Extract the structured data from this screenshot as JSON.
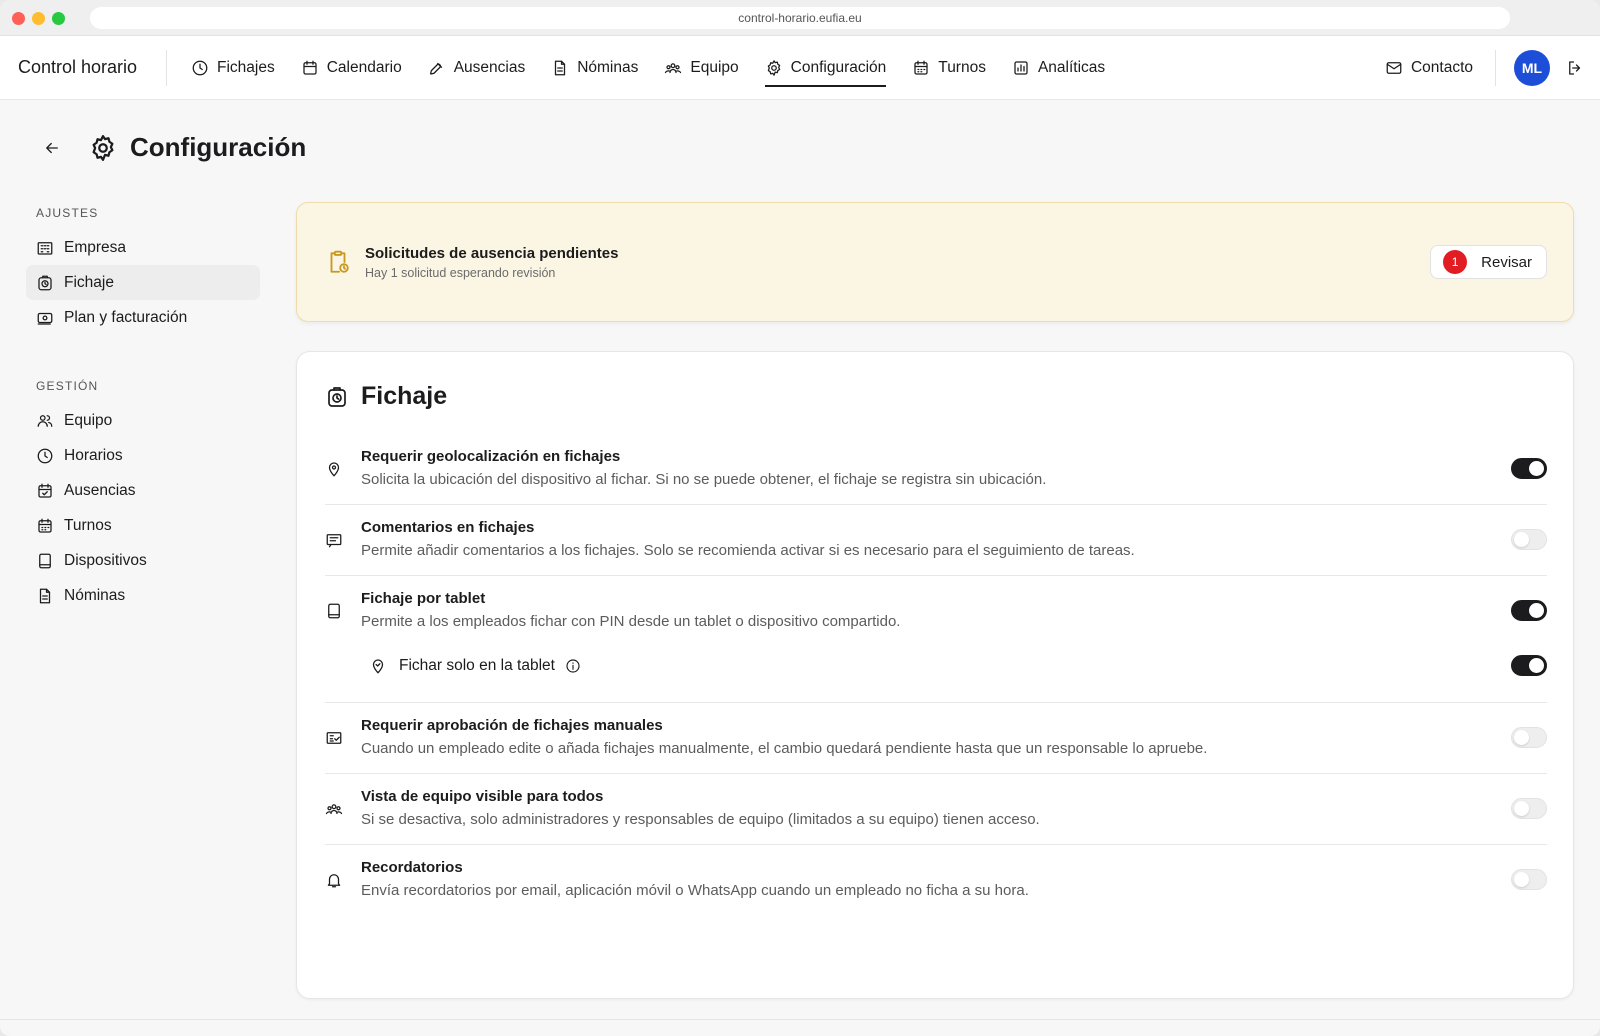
{
  "browser": {
    "url": "control-horario.eufia.eu"
  },
  "app": {
    "brand": "Control horario"
  },
  "nav": {
    "items": [
      {
        "label": "Fichajes",
        "icon": "clock-icon"
      },
      {
        "label": "Calendario",
        "icon": "calendar-icon"
      },
      {
        "label": "Ausencias",
        "icon": "plane-icon"
      },
      {
        "label": "Nóminas",
        "icon": "document-icon"
      },
      {
        "label": "Equipo",
        "icon": "team-icon"
      },
      {
        "label": "Configuración",
        "icon": "gear-icon",
        "active": true
      },
      {
        "label": "Turnos",
        "icon": "calendar-icon"
      },
      {
        "label": "Analíticas",
        "icon": "chart-icon"
      }
    ],
    "contact": "Contacto",
    "avatar_initials": "ML",
    "avatar_color": "#1d4ed8"
  },
  "page": {
    "title": "Configuración"
  },
  "sidebar": {
    "groups": [
      {
        "title": "AJUSTES",
        "items": [
          {
            "label": "Empresa",
            "icon": "building-icon"
          },
          {
            "label": "Fichaje",
            "icon": "clock-box-icon",
            "active": true
          },
          {
            "label": "Plan y facturación",
            "icon": "money-icon"
          }
        ]
      },
      {
        "title": "GESTIÓN",
        "items": [
          {
            "label": "Equipo",
            "icon": "users-icon"
          },
          {
            "label": "Horarios",
            "icon": "clock-icon"
          },
          {
            "label": "Ausencias",
            "icon": "calendar-check-icon"
          },
          {
            "label": "Turnos",
            "icon": "calendar-icon"
          },
          {
            "label": "Dispositivos",
            "icon": "tablet-icon"
          },
          {
            "label": "Nóminas",
            "icon": "document-icon"
          }
        ]
      }
    ]
  },
  "alert": {
    "title": "Solicitudes de ausencia pendientes",
    "subtitle": "Hay 1 solicitud esperando revisión",
    "badge": "1",
    "button": "Revisar",
    "accent": "#e11d23"
  },
  "card": {
    "title": "Fichaje",
    "settings": [
      {
        "title": "Requerir geolocalización en fichajes",
        "desc": "Solicita la ubicación del dispositivo al fichar. Si no se puede obtener, el fichaje se registra sin ubicación.",
        "on": true,
        "icon": "location-pin-icon"
      },
      {
        "title": "Comentarios en fichajes",
        "desc": "Permite añadir comentarios a los fichajes. Solo se recomienda activar si es necesario para el seguimiento de tareas.",
        "on": false,
        "icon": "comment-icon"
      },
      {
        "title": "Fichaje por tablet",
        "desc": "Permite a los empleados fichar con PIN desde un tablet o dispositivo compartido.",
        "on": true,
        "icon": "tablet-icon",
        "sub": {
          "label": "Fichar solo en la tablet",
          "on": true
        }
      },
      {
        "title": "Requerir aprobación de fichajes manuales",
        "desc": "Cuando un empleado edite o añada fichajes manualmente, el cambio quedará pendiente hasta que un responsable lo apruebe.",
        "on": false,
        "icon": "checklist-icon"
      },
      {
        "title": "Vista de equipo visible para todos",
        "desc": "Si se desactiva, solo administradores y responsables de equipo (limitados a su equipo) tienen acceso.",
        "on": false,
        "icon": "team-icon"
      },
      {
        "title": "Recordatorios",
        "desc": "Envía recordatorios por email, aplicación móvil o WhatsApp cuando un empleado no ficha a su hora.",
        "on": false,
        "icon": "bell-icon"
      }
    ]
  }
}
